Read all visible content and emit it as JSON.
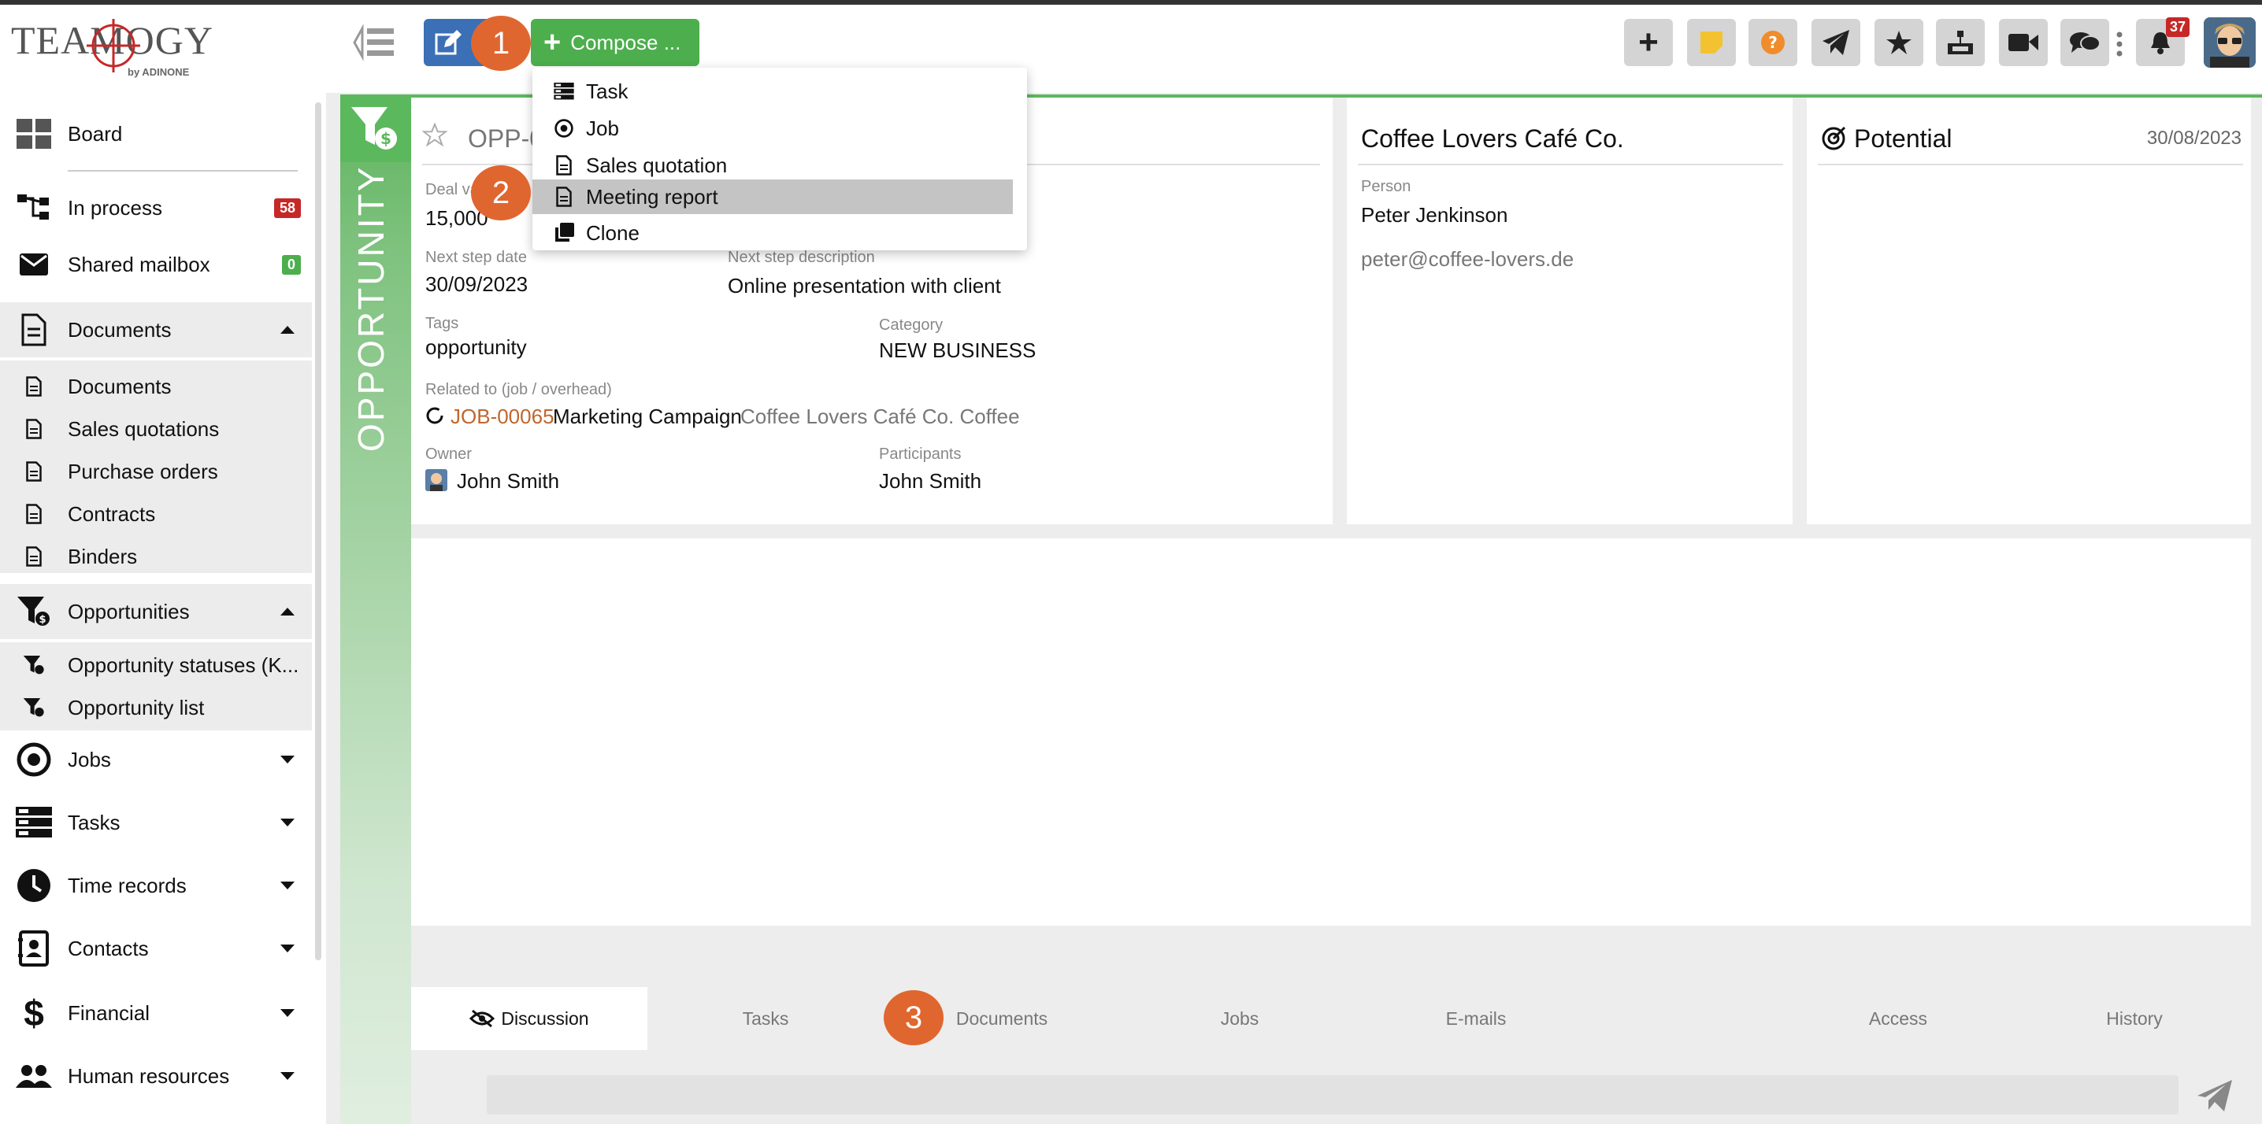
{
  "app": {
    "logo_text": "TEAMOGY",
    "logo_sub": "by ADINONE"
  },
  "header": {
    "compose_label": "Compose ...",
    "notification_count": "37",
    "accent_colors": {
      "compose": "#4cae4c",
      "edit": "#3b6fb6",
      "step": "#e0662f"
    }
  },
  "compose_menu": {
    "items": [
      {
        "label": "Task",
        "icon": "task-icon"
      },
      {
        "label": "Job",
        "icon": "target-icon"
      },
      {
        "label": "Sales quotation",
        "icon": "document-icon"
      },
      {
        "label": "Meeting report",
        "icon": "document-icon",
        "highlighted": true
      },
      {
        "label": "Clone",
        "icon": "clone-icon"
      }
    ]
  },
  "steps": {
    "s1": "1",
    "s2": "2",
    "s3": "3"
  },
  "sidebar": {
    "board": "Board",
    "in_process": "In process",
    "in_process_count": "58",
    "shared_mailbox": "Shared mailbox",
    "shared_mailbox_count": "0",
    "documents": "Documents",
    "documents_children": [
      "Documents",
      "Sales quotations",
      "Purchase orders",
      "Contracts",
      "Binders"
    ],
    "opportunities": "Opportunities",
    "opportunity_statuses": "Opportunity statuses (K...",
    "opportunity_list": "Opportunity list",
    "jobs": "Jobs",
    "tasks": "Tasks",
    "time_records": "Time records",
    "contacts": "Contacts",
    "financial": "Financial",
    "human_resources": "Human resources"
  },
  "opportunity": {
    "rail_label": "OPPORTUNITY",
    "id": "OPP-0",
    "deal_value_label": "Deal va",
    "deal_value": "15,000",
    "next_step_date_label": "Next step date",
    "next_step_date": "30/09/2023",
    "next_step_desc_label": "Next step description",
    "next_step_desc": "Online presentation with client",
    "tags_label": "Tags",
    "tags": "opportunity",
    "category_label": "Category",
    "category": "NEW BUSINESS",
    "related_label": "Related to (job / overhead)",
    "related_job_id": "JOB-00065",
    "related_job_name": "Marketing Campaign",
    "related_job_client": "Coffee Lovers Café Co. Coffee",
    "owner_label": "Owner",
    "owner": "John Smith",
    "participants_label": "Participants",
    "participants": "John Smith"
  },
  "company": {
    "name": "Coffee Lovers Café Co.",
    "person_label": "Person",
    "person": "Peter Jenkinson",
    "email": "peter@coffee-lovers.de"
  },
  "potential": {
    "title": "Potential",
    "date": "30/08/2023"
  },
  "tabs": {
    "discussion": "Discussion",
    "tasks": "Tasks",
    "documents": "Documents",
    "jobs": "Jobs",
    "emails": "E-mails",
    "access": "Access",
    "history": "History"
  }
}
